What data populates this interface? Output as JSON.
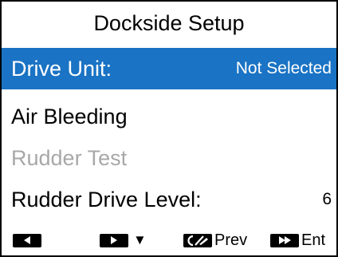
{
  "title": "Dockside Setup",
  "menu": [
    {
      "label": "Drive Unit:",
      "value": "Not Selected",
      "state": "selected"
    },
    {
      "label": "Air Bleeding",
      "value": "",
      "state": "normal"
    },
    {
      "label": "Rudder Test",
      "value": "",
      "state": "disabled"
    },
    {
      "label": "Rudder Drive Level:",
      "value": "6",
      "state": "normal"
    }
  ],
  "softkeys": {
    "left": {
      "icon": "arrow-left-icon"
    },
    "right": {
      "icon": "arrow-right-icon",
      "arrow": "▼"
    },
    "prev": {
      "icon": "pencil-icon",
      "label": "Prev"
    },
    "ent": {
      "icon": "double-arrow-right-icon",
      "label": "Ent"
    }
  },
  "colors": {
    "highlight": "#1a73c4",
    "disabled_text": "#a8a8a8"
  }
}
